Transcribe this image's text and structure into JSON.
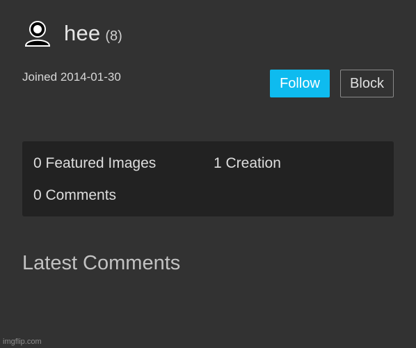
{
  "profile": {
    "avatar_icon": "user-icon",
    "username": "hee",
    "points": "(8)",
    "joined": "Joined 2014-01-30"
  },
  "actions": {
    "follow_label": "Follow",
    "block_label": "Block",
    "follow_color": "#0ebbef"
  },
  "stats": {
    "featured_images": "0 Featured Images",
    "creations": "1 Creation",
    "comments": "0 Comments"
  },
  "latest_comments": {
    "heading": "Latest Comments"
  },
  "watermark": "imgflip.com"
}
